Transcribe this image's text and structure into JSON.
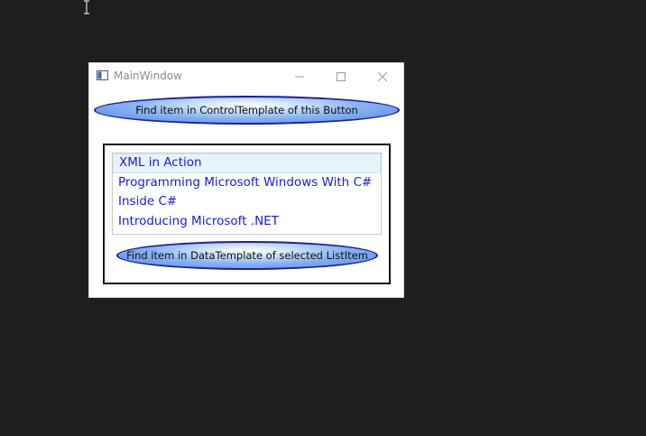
{
  "window": {
    "title": "MainWindow"
  },
  "buttons": {
    "control_template_label": "Find item in ControlTemplate of this Button",
    "data_template_label": "Find item in DataTemplate of selected ListItem"
  },
  "listbox": {
    "selected_index": 0,
    "items": [
      {
        "label": "XML in Action"
      },
      {
        "label": "Programming Microsoft Windows With C#"
      },
      {
        "label": "Inside C#"
      },
      {
        "label": "Introducing Microsoft .NET"
      }
    ]
  },
  "colors": {
    "desktop_background": "#1e1e1e",
    "item_text": "#1a1ad8",
    "button_border": "#1f1f9c",
    "button_fill": "#6a9af0",
    "selection": "#e5f3fb"
  },
  "icons": {
    "cursor": "ibeam-cursor-icon",
    "app": "app-window-icon",
    "minimize": "minimize-icon",
    "maximize": "maximize-icon",
    "close": "close-icon"
  }
}
